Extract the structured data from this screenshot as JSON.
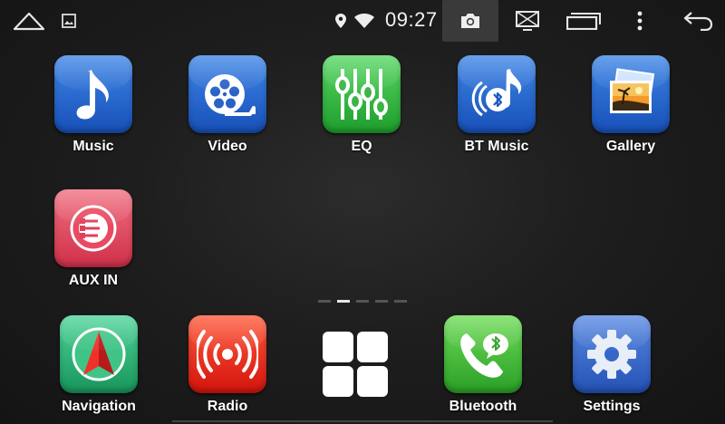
{
  "status_bar": {
    "time": "09:27",
    "left_icons": [
      "home-icon",
      "picture-icon"
    ],
    "right_icons": [
      "location-icon",
      "wifi-icon",
      "camera-icon",
      "screen-mirror-icon",
      "recent-apps-icon",
      "more-icon",
      "back-icon"
    ]
  },
  "apps_row1": [
    {
      "label": "Music",
      "icon": "music-note-icon"
    },
    {
      "label": "Video",
      "icon": "film-reel-icon"
    },
    {
      "label": "EQ",
      "icon": "equalizer-icon"
    },
    {
      "label": "BT Music",
      "icon": "bt-music-icon"
    },
    {
      "label": "Gallery",
      "icon": "gallery-icon"
    }
  ],
  "apps_row2": [
    {
      "label": "AUX IN",
      "icon": "aux-plug-icon"
    }
  ],
  "page_indicator": {
    "count": 5,
    "active_index": 1
  },
  "dock": [
    {
      "label": "Navigation",
      "icon": "navigation-arrow-icon"
    },
    {
      "label": "Radio",
      "icon": "radio-waves-icon"
    },
    {
      "label": "",
      "icon": "all-apps-icon"
    },
    {
      "label": "Bluetooth",
      "icon": "bluetooth-phone-icon"
    },
    {
      "label": "Settings",
      "icon": "gear-icon"
    }
  ]
}
